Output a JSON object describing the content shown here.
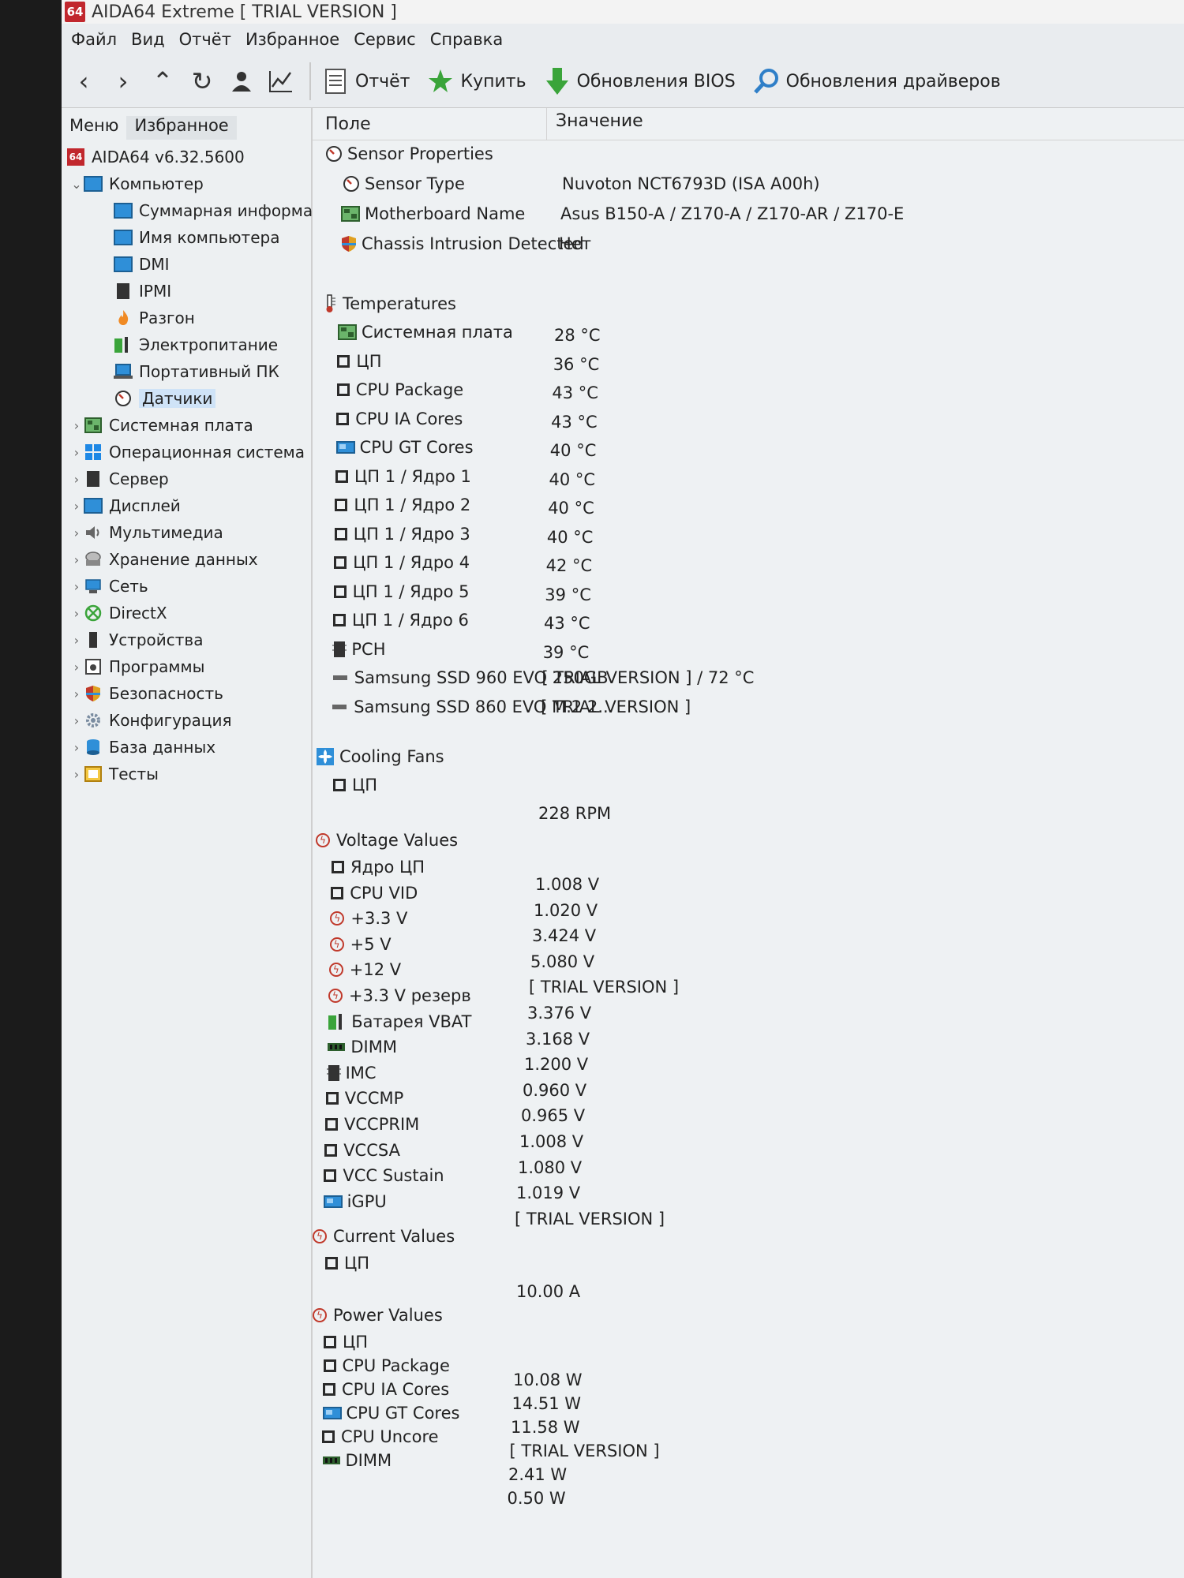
{
  "window": {
    "title": "AIDA64 Extreme  [ TRIAL VERSION ]",
    "app_icon_text": "64"
  },
  "menu": [
    "Файл",
    "Вид",
    "Отчёт",
    "Избранное",
    "Сервис",
    "Справка"
  ],
  "toolbar": {
    "report": "Отчёт",
    "buy": "Купить",
    "bios_updates": "Обновления BIOS",
    "driver_updates": "Обновления драйверов"
  },
  "left_tabs": [
    "Меню",
    "Избранное"
  ],
  "tree": {
    "root": "AIDA64 v6.32.5600",
    "computer": "Компьютер",
    "computer_children": [
      "Суммарная информа",
      "Имя компьютера",
      "DMI",
      "IPMI",
      "Разгон",
      "Электропитание",
      "Портативный ПК",
      "Датчики"
    ],
    "categories": [
      "Системная плата",
      "Операционная система",
      "Сервер",
      "Дисплей",
      "Мультимедиа",
      "Хранение данных",
      "Сеть",
      "DirectX",
      "Устройства",
      "Программы",
      "Безопасность",
      "Конфигурация",
      "База данных",
      "Тесты"
    ]
  },
  "columns": {
    "field": "Поле",
    "value": "Значение"
  },
  "sensor_properties": {
    "title": "Sensor Properties",
    "rows": [
      {
        "name": "Sensor Type",
        "value": "Nuvoton NCT6793D  (ISA A00h)"
      },
      {
        "name": "Motherboard Name",
        "value": "Asus B150-A / Z170-A / Z170-AR / Z170-E"
      },
      {
        "name": "Chassis Intrusion Detected",
        "value": "Нет"
      }
    ]
  },
  "temperatures": {
    "title": "Temperatures",
    "rows": [
      {
        "name": "Системная плата",
        "value": "28 °C"
      },
      {
        "name": "ЦП",
        "value": "36 °C"
      },
      {
        "name": "CPU Package",
        "value": "43 °C"
      },
      {
        "name": "CPU IA Cores",
        "value": "43 °C"
      },
      {
        "name": "CPU GT Cores",
        "value": "40 °C"
      },
      {
        "name": "ЦП 1 / Ядро 1",
        "value": "40 °C"
      },
      {
        "name": "ЦП 1 / Ядро 2",
        "value": "40 °C"
      },
      {
        "name": "ЦП 1 / Ядро 3",
        "value": "40 °C"
      },
      {
        "name": "ЦП 1 / Ядро 4",
        "value": "42 °C"
      },
      {
        "name": "ЦП 1 / Ядро 5",
        "value": "39 °C"
      },
      {
        "name": "ЦП 1 / Ядро 6",
        "value": "43 °C"
      },
      {
        "name": "PCH",
        "value": "39 °C"
      },
      {
        "name": "Samsung SSD 960 EVO 250GB",
        "value": "[ TRIAL VERSION ] / 72 °C"
      },
      {
        "name": "Samsung SSD 860 EVO M.2 2...",
        "value": "[ TRIAL VERSION ]"
      }
    ]
  },
  "cooling_fans": {
    "title": "Cooling Fans",
    "rows": [
      {
        "name": "ЦП",
        "value": "228 RPM"
      }
    ]
  },
  "voltage_values": {
    "title": "Voltage Values",
    "rows": [
      {
        "name": "Ядро ЦП",
        "value": "1.008 V"
      },
      {
        "name": "CPU VID",
        "value": "1.020 V"
      },
      {
        "name": "+3.3 V",
        "value": "3.424 V"
      },
      {
        "name": "+5 V",
        "value": "5.080 V"
      },
      {
        "name": "+12 V",
        "value": "[ TRIAL VERSION ]"
      },
      {
        "name": "+3.3 V резерв",
        "value": "3.376 V"
      },
      {
        "name": "Батарея VBAT",
        "value": "3.168 V"
      },
      {
        "name": "DIMM",
        "value": "1.200 V"
      },
      {
        "name": "IMC",
        "value": "0.960 V"
      },
      {
        "name": "VCCMP",
        "value": "0.965 V"
      },
      {
        "name": "VCCPRIM",
        "value": "1.008 V"
      },
      {
        "name": "VCCSA",
        "value": "1.080 V"
      },
      {
        "name": "VCC Sustain",
        "value": "1.019 V"
      },
      {
        "name": "iGPU",
        "value": "[ TRIAL VERSION ]"
      }
    ]
  },
  "current_values": {
    "title": "Current Values",
    "rows": [
      {
        "name": "ЦП",
        "value": "10.00 A"
      }
    ]
  },
  "power_values": {
    "title": "Power Values",
    "rows": [
      {
        "name": "ЦП",
        "value": "10.08 W"
      },
      {
        "name": "CPU Package",
        "value": "14.51 W"
      },
      {
        "name": "CPU IA Cores",
        "value": "11.58 W"
      },
      {
        "name": "CPU GT Cores",
        "value": "[ TRIAL VERSION ]"
      },
      {
        "name": "CPU Uncore",
        "value": "2.41 W"
      },
      {
        "name": "DIMM",
        "value": "0.50 W"
      }
    ]
  }
}
